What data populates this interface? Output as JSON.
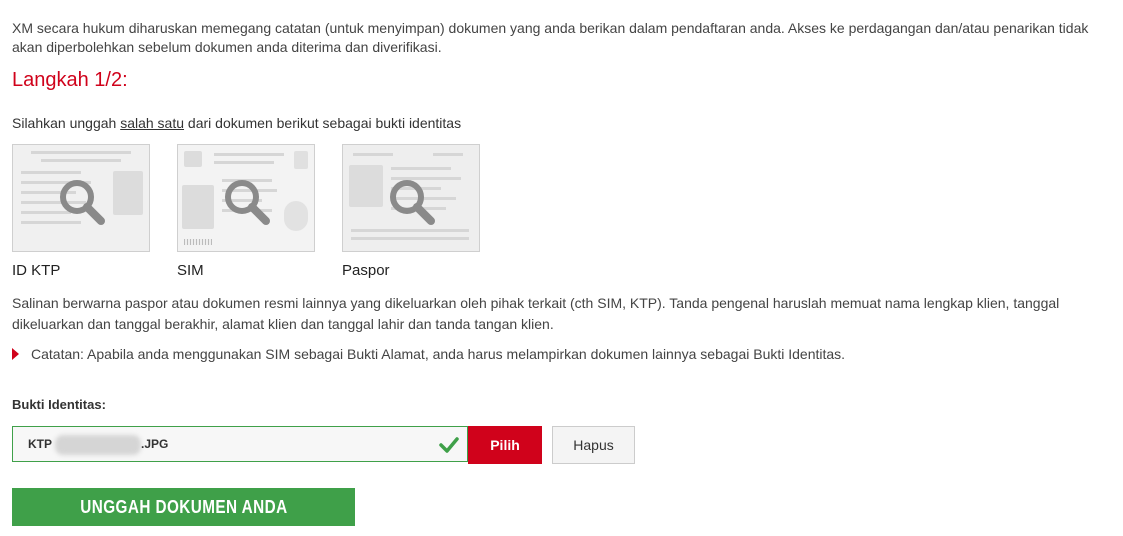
{
  "intro": "XM secara hukum diharuskan memegang catatan (untuk menyimpan) dokumen yang anda berikan dalam pendaftaran anda. Akses ke perdagangan dan/atau penarikan tidak akan diperbolehkan sebelum dokumen anda diterima dan diverifikasi.",
  "step_title": "Langkah 1/2:",
  "instruction": {
    "before": "Silahkan unggah ",
    "emphasis": "salah satu",
    "after": " dari dokumen berikut sebagai bukti identitas"
  },
  "documents": [
    {
      "label": "ID KTP",
      "icon": "magnifier-icon"
    },
    {
      "label": "SIM",
      "icon": "magnifier-icon"
    },
    {
      "label": "Paspor",
      "icon": "magnifier-icon"
    }
  ],
  "description": "Salinan berwarna paspor atau dokumen resmi lainnya yang dikeluarkan oleh pihak terkait (cth SIM, KTP). Tanda pengenal haruslah memuat nama lengkap klien, tanggal dikeluarkan dan tanggal berakhir, alamat klien dan tanggal lahir dan tanda tangan klien.",
  "note": "Catatan: Apabila anda menggunakan SIM sebagai Bukti Alamat, anda harus melampirkan dokumen lainnya sebagai Bukti Identitas.",
  "proof_field": {
    "label": "Bukti Identitas:",
    "file_prefix": "KTP",
    "file_suffix": ".JPG",
    "valid_icon": "checkmark-icon"
  },
  "buttons": {
    "choose": "Pilih",
    "remove": "Hapus",
    "upload": "UNGGAH DOKUMEN ANDA"
  },
  "colors": {
    "accent_red": "#d0021b",
    "success_green": "#3fa049"
  }
}
